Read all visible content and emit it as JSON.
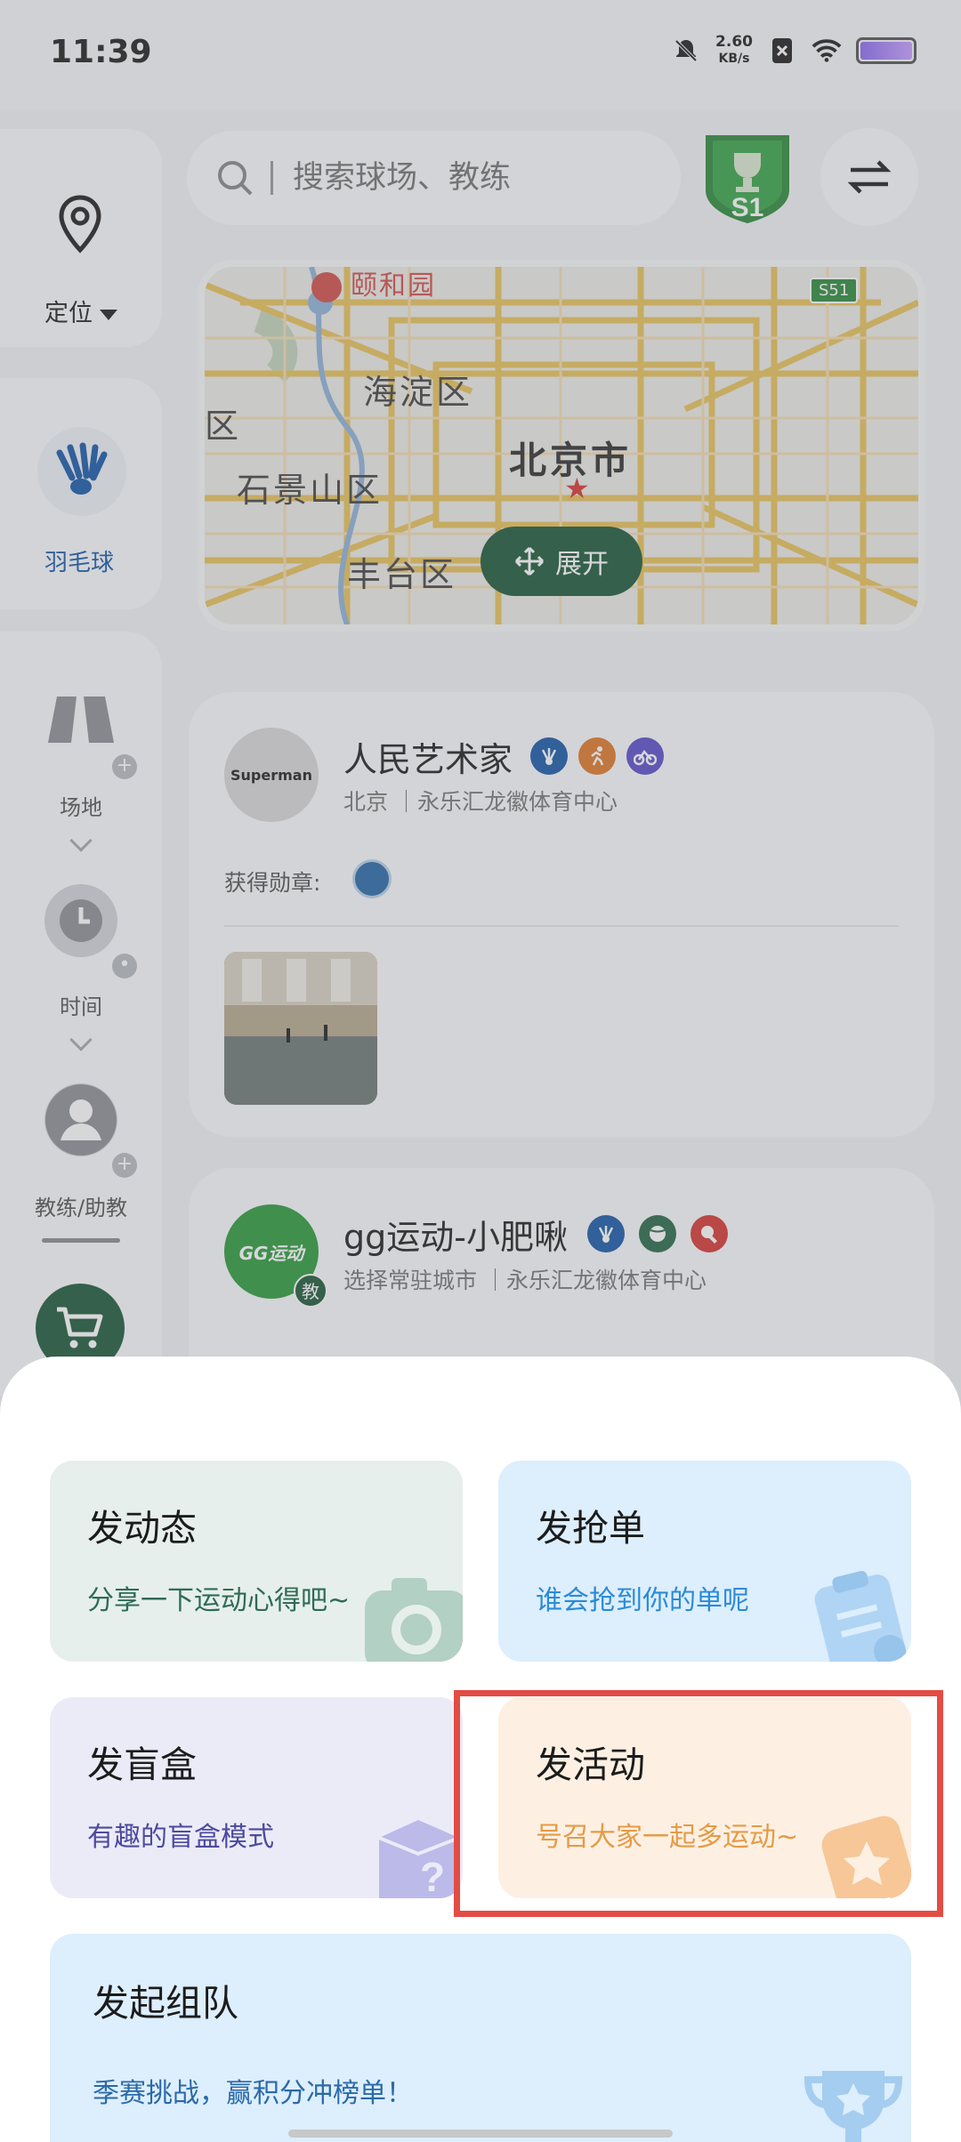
{
  "status_bar": {
    "time": "11:39",
    "speed_value": "2.60",
    "speed_unit": "KB/s"
  },
  "sidebar": {
    "location_label": "定位",
    "sport_label": "羽毛球",
    "filters": [
      {
        "label": "场地",
        "icon": "court-icon"
      },
      {
        "label": "时间",
        "icon": "clock-icon"
      },
      {
        "label": "教练/助教",
        "icon": "coach-icon"
      }
    ]
  },
  "header": {
    "search_placeholder": "搜索球场、教练",
    "season_badge": "S1"
  },
  "map": {
    "city": "北京市",
    "poi": "颐和园",
    "districts": [
      "海淀区",
      "石景山区",
      "丰台区",
      "区"
    ],
    "road_badge": "S51",
    "expand_label": "展开"
  },
  "feed": [
    {
      "name": "人民艺术家",
      "city": "北京",
      "venue": "｜永乐汇龙徽体育中心",
      "medal_label": "获得勋章:",
      "avatar_text": "Superman"
    },
    {
      "name": "gg运动-小肥啾",
      "city": "选择常驻城市",
      "venue": "｜永乐汇龙徽体育中心",
      "avatar_text": "GG运动",
      "tag": "教"
    }
  ],
  "sheet": {
    "moment": {
      "title": "发动态",
      "subtitle": "分享一下运动心得吧~"
    },
    "grab": {
      "title": "发抢单",
      "subtitle": "谁会抢到你的单呢"
    },
    "blind_box": {
      "title": "发盲盒",
      "subtitle": "有趣的盲盒模式"
    },
    "event": {
      "title": "发活动",
      "subtitle": "号召大家一起多运动~"
    },
    "team": {
      "title": "发起组队",
      "subtitle": "季赛挑战，赢积分冲榜单！"
    }
  },
  "colors": {
    "brand_green": "#1f5a3b",
    "highlight_red": "#e34b45"
  }
}
